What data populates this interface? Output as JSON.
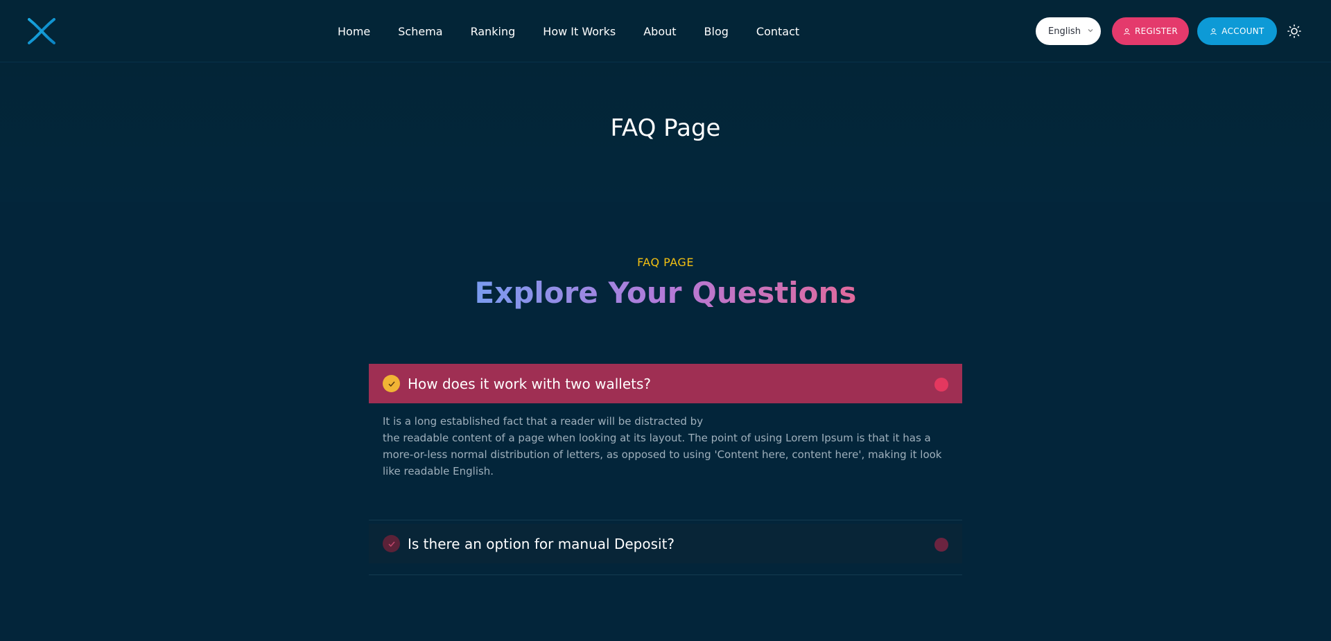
{
  "header": {
    "logo_icon": "x-logo-icon",
    "nav": [
      {
        "label": "Home"
      },
      {
        "label": "Schema"
      },
      {
        "label": "Ranking"
      },
      {
        "label": "How It Works"
      },
      {
        "label": "About"
      },
      {
        "label": "Blog"
      },
      {
        "label": "Contact"
      }
    ],
    "language": {
      "selected": "English"
    },
    "register_label": "REGISTER",
    "account_label": "ACCOUNT",
    "theme_icon": "sun-icon"
  },
  "banner": {
    "title": "FAQ Page"
  },
  "section": {
    "kicker": "FAQ PAGE",
    "heading": "Explore Your Questions"
  },
  "faq": [
    {
      "question": "How does it work with two wallets?",
      "expanded": true,
      "answer_lines": [
        "It is a long established fact that a reader will be distracted by",
        "the readable content of a page when looking at its layout. The point of using Lorem Ipsum is that it has a more-or-less normal distribution of letters, as opposed to using 'Content here, content here', making it look like readable English."
      ]
    },
    {
      "question": "Is there an option for manual Deposit?",
      "expanded": false
    }
  ],
  "colors": {
    "background": "#03253a",
    "accent_pink": "#e43a6c",
    "accent_blue": "#0d9ad6",
    "kicker_yellow": "#f3c012",
    "active_faq": "#9f2f53"
  }
}
